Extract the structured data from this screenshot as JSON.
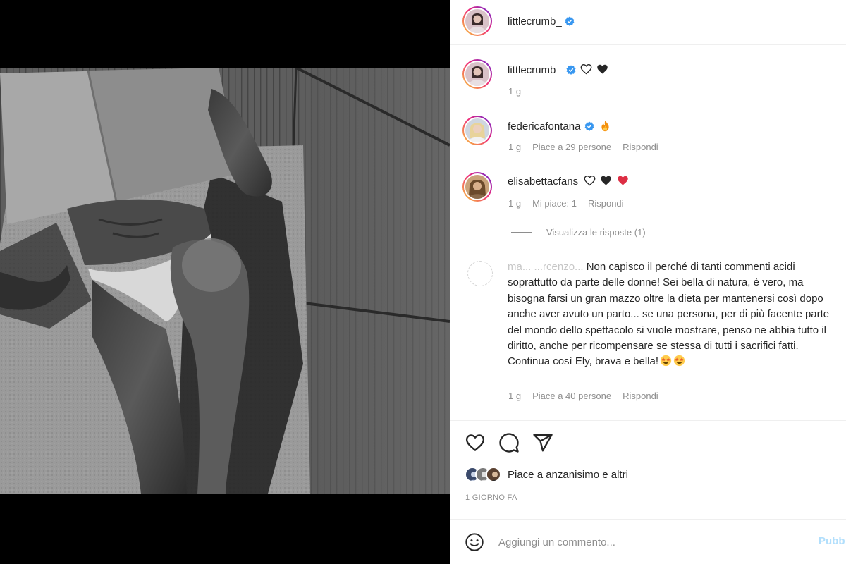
{
  "post": {
    "author": "littlecrumb_",
    "verified": true
  },
  "caption": {
    "username": "littlecrumb_",
    "hearts": [
      "white-heart",
      "black-heart"
    ],
    "time": "1 g"
  },
  "comments": [
    {
      "username": "federicafontana",
      "verified": true,
      "emoji": [
        "fire"
      ],
      "time": "1 g",
      "likes": "Piace a 29 persone",
      "reply": "Rispondi"
    },
    {
      "username": "elisabettacfans",
      "verified": false,
      "emoji": [
        "white-heart",
        "black-heart",
        "red-heart"
      ],
      "time": "1 g",
      "likes": "Mi piace: 1",
      "reply": "Rispondi"
    }
  ],
  "view_replies": "Visualizza le risposte (1)",
  "long_comment": {
    "username_fragment": "ma... ...rcenzo...",
    "text": "Non capisco il perché di tanti commenti acidi soprattutto da parte delle donne! Sei bella di natura, è vero, ma bisogna farsi un gran mazzo oltre la dieta per mantenersi così dopo anche aver avuto un parto... se una persona, per di più facente parte del mondo dello spettacolo si vuole mostrare, penso ne abbia tutto il diritto, anche per ricompensare se stessa di tutti i sacrifici fatti. Continua così Ely, brava e bella!",
    "emoji": [
      "star-struck",
      "star-struck"
    ],
    "time": "1 g",
    "likes": "Piace a 40 persone",
    "reply": "Rispondi"
  },
  "actions": {
    "icons": [
      "heart-outline-icon",
      "comment-icon",
      "share-icon"
    ]
  },
  "likes_summary": "Piace a anzanisimo e altri",
  "timestamp": "1 GIORNO FA",
  "comment_box": {
    "placeholder": "Aggiungi un commento...",
    "publish": "Pubb"
  },
  "carousel": {
    "count": 2,
    "active_index": 1
  },
  "colors": {
    "verified_blue": "#3897f0",
    "meta_gray": "#8e8e8e",
    "publish_disabled": "#b2dffc"
  }
}
